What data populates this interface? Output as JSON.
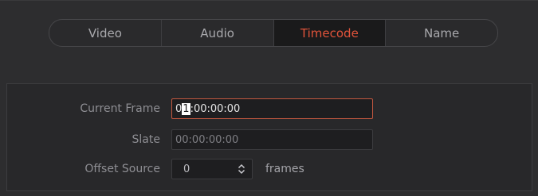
{
  "tabs": [
    {
      "label": "Video",
      "active": false
    },
    {
      "label": "Audio",
      "active": false
    },
    {
      "label": "Timecode",
      "active": true
    },
    {
      "label": "Name",
      "active": false
    }
  ],
  "fields": {
    "current_frame": {
      "label": "Current Frame",
      "value_prefix": "0",
      "value_caret": "1",
      "value_suffix": ":00:00:00"
    },
    "slate": {
      "label": "Slate",
      "value": "00:00:00:00"
    },
    "offset_source": {
      "label": "Offset Source",
      "value": "0",
      "unit": "frames"
    }
  },
  "colors": {
    "accent": "#e0533a",
    "focus_border": "#c2573f"
  },
  "icons": {
    "stepper": "chevron-up-down-icon"
  }
}
